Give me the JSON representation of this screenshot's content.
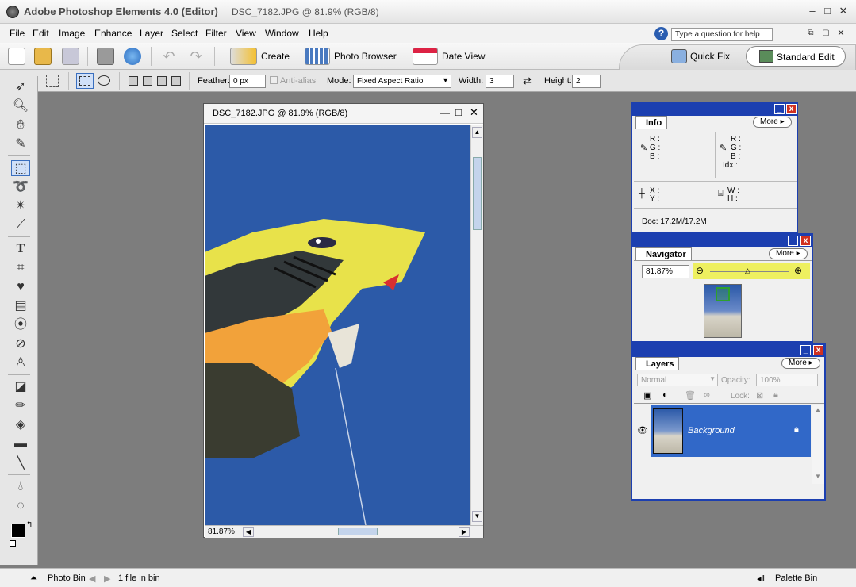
{
  "window": {
    "app_title": "Adobe Photoshop Elements 4.0 (Editor)",
    "doc_title": "DSC_7182.JPG @ 81.9% (RGB/8)"
  },
  "menu": [
    "File",
    "Edit",
    "Image",
    "Enhance",
    "Layer",
    "Select",
    "Filter",
    "View",
    "Window",
    "Help"
  ],
  "help": {
    "placeholder": "Type a question for help"
  },
  "shortcuts": {
    "create": "Create",
    "photo_browser": "Photo Browser",
    "date_view": "Date View",
    "quick_fix": "Quick Fix",
    "standard_edit": "Standard Edit"
  },
  "options": {
    "feather_label": "Feather:",
    "feather_value": "0 px",
    "anti_alias": "Anti-alias",
    "mode_label": "Mode:",
    "mode_value": "Fixed Aspect Ratio",
    "width_label": "Width:",
    "width_value": "3",
    "height_label": "Height:",
    "height_value": "2"
  },
  "document": {
    "title": "DSC_7182.JPG @ 81.9% (RGB/8)",
    "zoom": "81.87%"
  },
  "info_panel": {
    "tab": "Info",
    "more": "More",
    "r": "R :",
    "g": "G :",
    "b": "B :",
    "idx": "Idx :",
    "x": "X :",
    "y": "Y :",
    "w": "W :",
    "h": "H :",
    "doc": "Doc: 17.2M/17.2M"
  },
  "navigator_panel": {
    "tab": "Navigator",
    "more": "More",
    "zoom": "81.87%"
  },
  "layers_panel": {
    "tab": "Layers",
    "more": "More",
    "blend_mode": "Normal",
    "opacity_label": "Opacity:",
    "opacity_value": "100%",
    "lock_label": "Lock:",
    "layer_name": "Background"
  },
  "status": {
    "photo_bin": "Photo Bin",
    "files": "1 file in bin",
    "palette_bin": "Palette Bin"
  }
}
